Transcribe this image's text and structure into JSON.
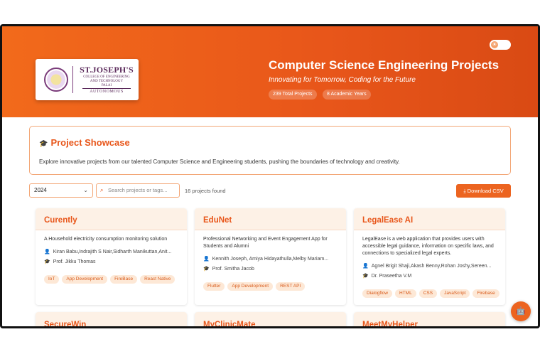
{
  "header": {
    "title": "Computer Science Engineering Projects",
    "subtitle": "Innovating for Tomorrow, Coding for the Future",
    "stats": [
      "239 Total Projects",
      "8 Academic Years"
    ],
    "logo": {
      "name": "ST.JOSEPH'S",
      "line1": "COLLEGE OF ENGINEERING",
      "line2": "AND TECHNOLOGY",
      "line3": "PALAI",
      "autonomous": "AUTONOMOUS"
    },
    "theme_toggle_icon": "sun-icon"
  },
  "showcase": {
    "title": "Project Showcase",
    "icon": "graduation-cap-icon",
    "description": "Explore innovative projects from our talented Computer Science and Engineering students, pushing the boundaries of technology and creativity."
  },
  "filters": {
    "year_selected": "2024",
    "search_placeholder": "Search projects or tags...",
    "count_text": "16 projects found",
    "download_label": "Download CSV"
  },
  "projects": [
    {
      "title": "Curently",
      "description": "A Household electricity consumption monitoring solution",
      "members": "Kiran Babu,Indrajith S Nair,Sidharth Manikuttan,Anit...",
      "guide": "Prof. Jikku Thomas",
      "tags": [
        "IoT",
        "App Development",
        "FireBase",
        "React Native"
      ]
    },
    {
      "title": "EduNet",
      "description": "Professional Networking and Event Engagement App for Students and Alumni",
      "members": "Kennith Joseph, Amiya Hidayathulla,Melby Mariam...",
      "guide": "Prof. Smitha Jacob",
      "tags": [
        "Flutter",
        "App Development",
        "REST API"
      ]
    },
    {
      "title": "LegalEase AI",
      "description": "LegalEase is a web application that provides users with accessible legal guidance, information on specific laws, and connections to specialized legal experts.",
      "members": "Agnel Brigit Shaji,Akash Benny,Rohan Joshy,Sereen...",
      "guide": "Dr. Praseetha V.M",
      "tags": [
        "Dialogflow",
        "HTML",
        "CSS",
        "JavaScript",
        "Firebase"
      ]
    }
  ],
  "projects_row2": [
    "SecureWin",
    "MyClinicMate",
    "MeetMyHelper"
  ],
  "colors": {
    "accent": "#e8561a",
    "tag_bg": "#fde8d6"
  }
}
